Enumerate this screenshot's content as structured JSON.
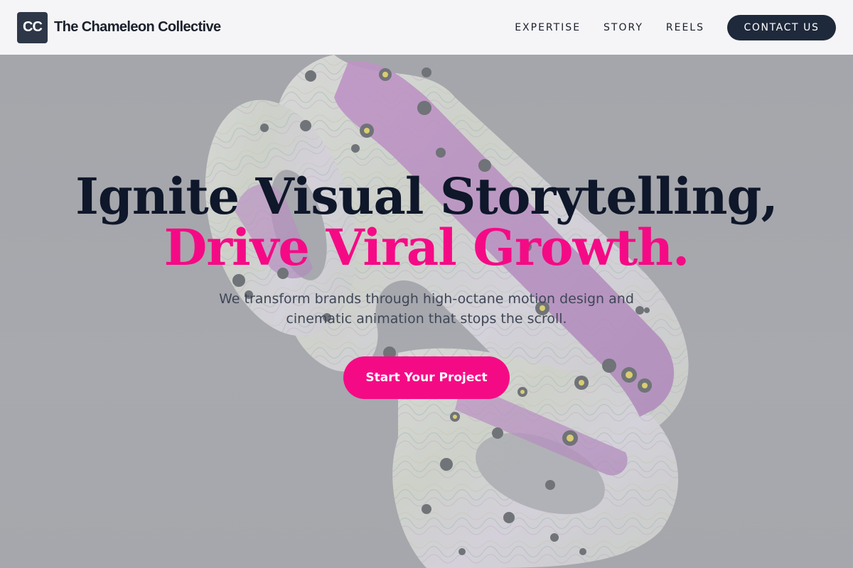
{
  "brand": {
    "logo_initials": "CC",
    "name": "The Chameleon Collective"
  },
  "nav": {
    "items": [
      {
        "label": "EXPERTISE"
      },
      {
        "label": "STORY"
      },
      {
        "label": "REELS"
      }
    ],
    "contact_label": "CONTACT US"
  },
  "hero": {
    "headline_line1": "Ignite Visual Storytelling,",
    "headline_line2": "Drive Viral Growth.",
    "subtitle": "We transform brands through high-octane motion design and cinematic animation that stops the scroll.",
    "cta_label": "Start Your Project",
    "background_image": "abstract-3d-iridescent-shape"
  },
  "colors": {
    "accent": "#f50a85",
    "dark": "#1e293b",
    "header_bg": "#f5f5f7",
    "hero_bg": "#a4a5aa"
  }
}
